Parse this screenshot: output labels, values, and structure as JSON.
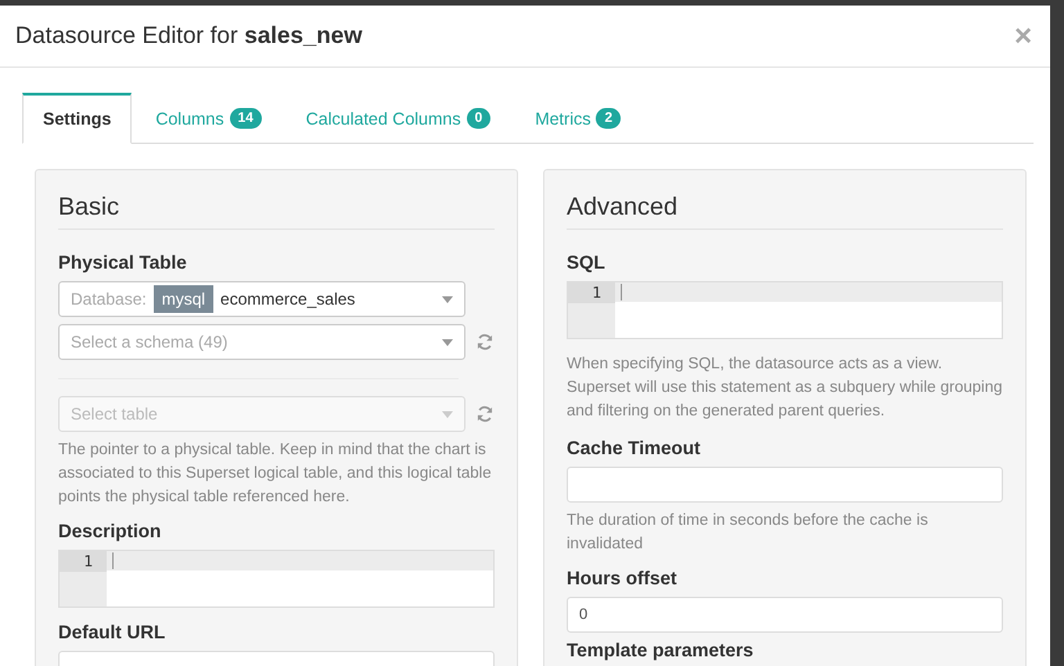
{
  "dialog": {
    "title": "Datasource Editor for **sales_new**",
    "close": "×"
  },
  "tabs": [
    {
      "label": "Settings",
      "selected": true
    },
    {
      "label": "Columns",
      "badge": "14",
      "selected": false
    },
    {
      "label": "Calculated Columns",
      "badge": "0",
      "selected": false
    },
    {
      "label": "Metrics",
      "badge": "2",
      "selected": false
    }
  ],
  "basic": {
    "heading": "Basic",
    "physical_table": {
      "label": "Physical Table",
      "database": {
        "label": "Database:",
        "badge": "mysql",
        "value": "ecommerce_sales"
      },
      "schema": {
        "placeholder": "Select a schema (49)",
        "disabled": false
      },
      "table": {
        "placeholder": "Select table",
        "disabled": true
      },
      "help": "The pointer to a physical table. Keep in mind that the chart is associated to this Superset logical table, and this logical table points the physical table referenced here."
    },
    "description": {
      "label": "Description",
      "line_numbers": [
        "1"
      ]
    },
    "default_url": {
      "label": "Default URL"
    }
  },
  "advanced": {
    "heading": "Advanced",
    "sql": {
      "label": "SQL",
      "line_numbers": [
        "1"
      ],
      "help": "When specifying SQL, the datasource acts as a view. Superset will use this statement as a subquery while grouping and filtering on the generated parent queries."
    },
    "cache_timeout": {
      "label": "Cache Timeout",
      "help": "The duration of time in seconds before the cache is invalidated"
    },
    "hours_offset": {
      "label": "Hours offset",
      "value": "0"
    },
    "template_parameters": {
      "label": "Template parameters"
    }
  }
}
